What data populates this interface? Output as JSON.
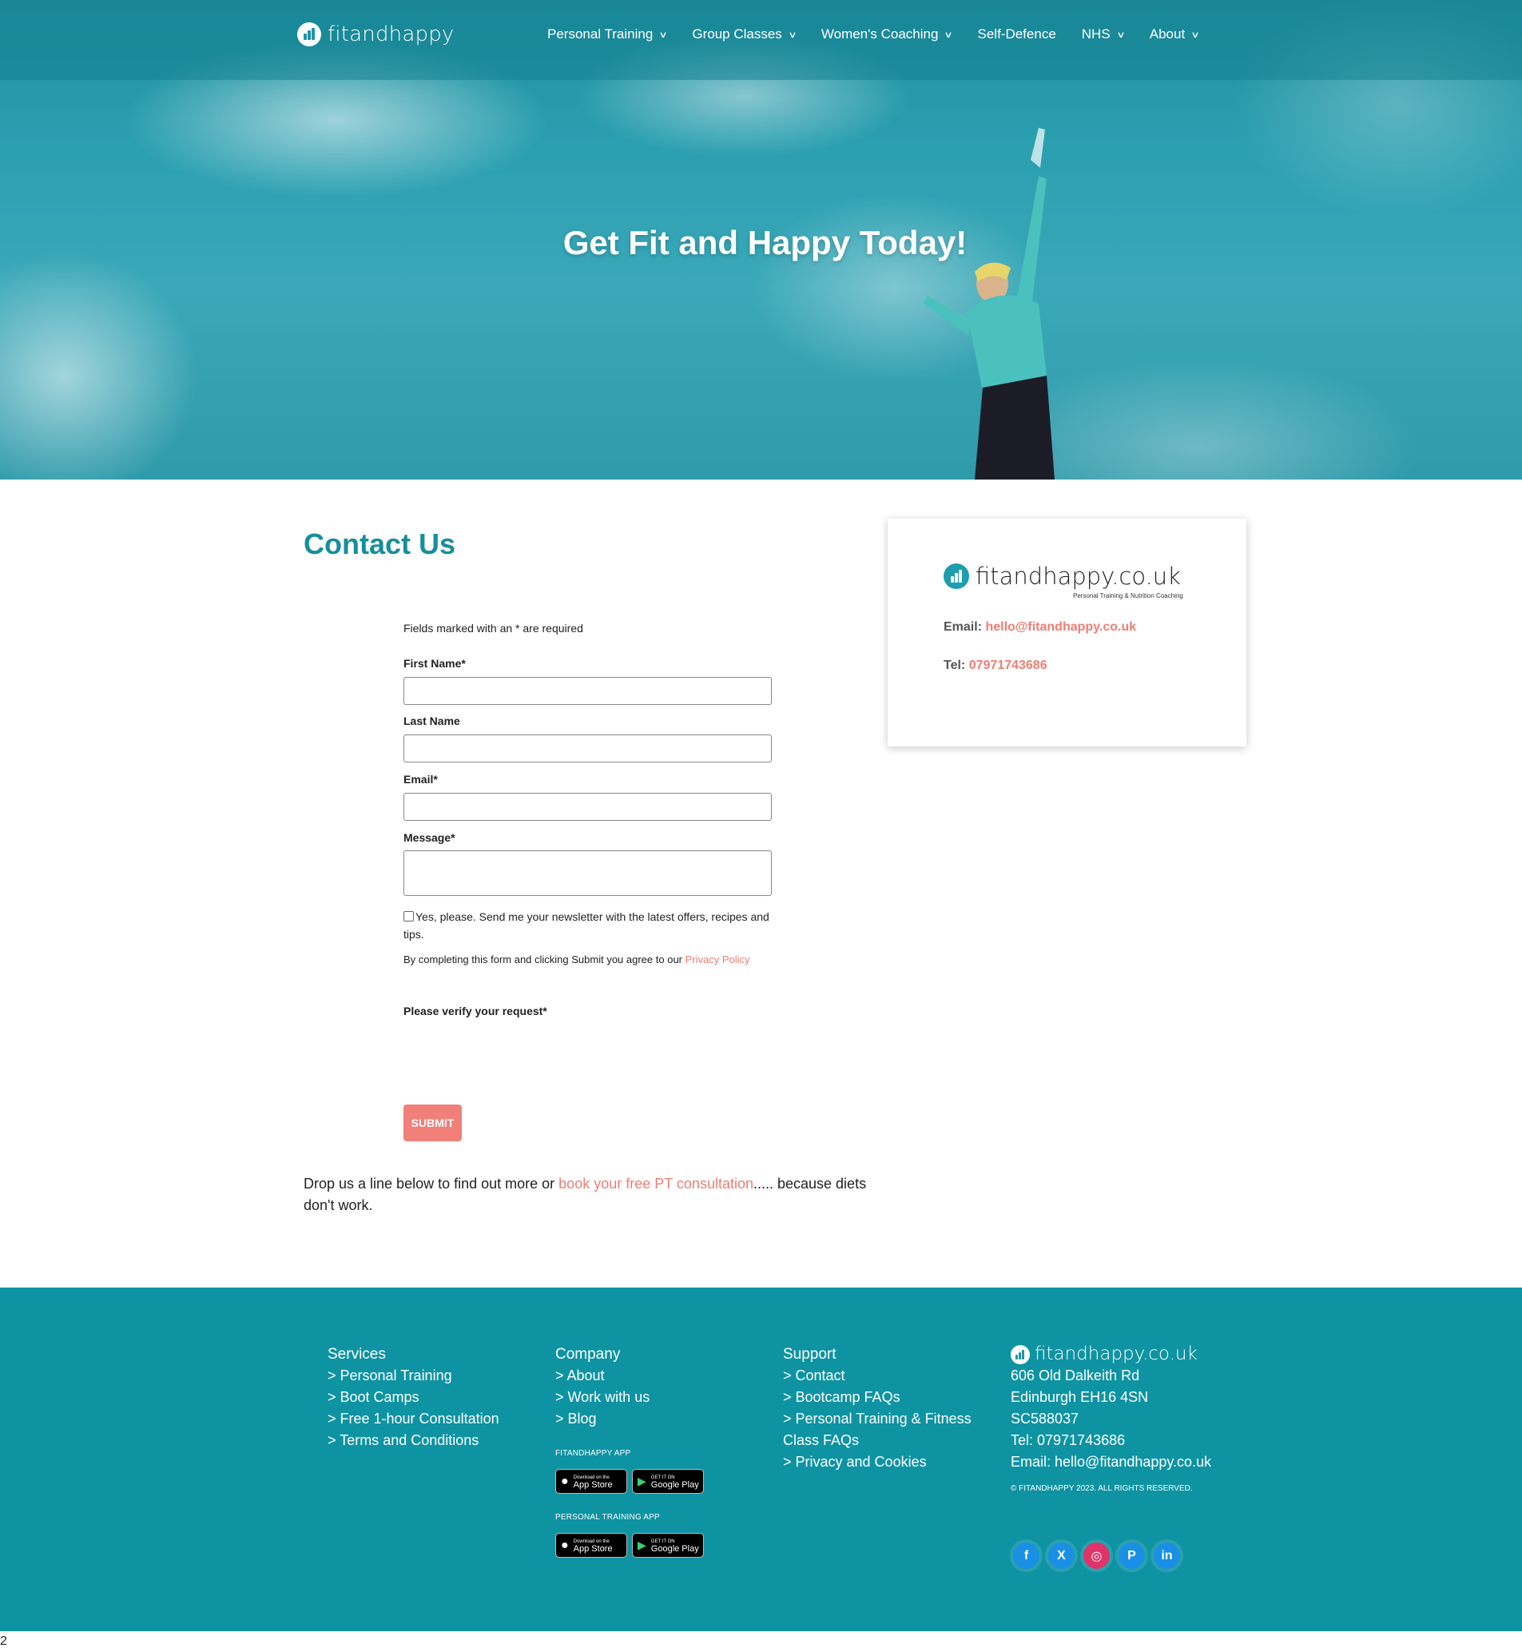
{
  "brand": {
    "name": "fitandhappy",
    "domain": "fitandhappy.co.uk",
    "tagline": "Personal Training & Nutrition Coaching",
    "accent": "#178e9b",
    "link_color": "#f07d74"
  },
  "nav": {
    "items": [
      {
        "label": "Personal Training",
        "has_dropdown": true
      },
      {
        "label": "Group Classes",
        "has_dropdown": true
      },
      {
        "label": "Women's Coaching",
        "has_dropdown": true
      },
      {
        "label": "Self-Defence",
        "has_dropdown": false
      },
      {
        "label": "NHS",
        "has_dropdown": true
      },
      {
        "label": "About",
        "has_dropdown": true
      }
    ]
  },
  "hero": {
    "title": "Get Fit and Happy Today!"
  },
  "contact": {
    "title": "Contact Us",
    "required_note": "Fields marked with an * are required",
    "fields": {
      "first_name": {
        "label": "First Name*",
        "value": ""
      },
      "last_name": {
        "label": "Last Name",
        "value": ""
      },
      "email": {
        "label": "Email*",
        "value": ""
      },
      "message": {
        "label": "Message*",
        "value": ""
      }
    },
    "newsletter_label": "Yes, please. Send me your newsletter with the latest offers, recipes and tips.",
    "newsletter_checked": false,
    "agree_text": "By completing this form and clicking Submit you agree to our ",
    "privacy_link": "Privacy Policy",
    "verify_label": "Please verify your request*",
    "submit_label": "SUBMIT",
    "drop_text_before": "Drop us a line below to find out more or ",
    "drop_link": "book your free PT consultation",
    "drop_text_after": "..... because diets don't work."
  },
  "card": {
    "email_label": "Email:",
    "email": "hello@fitandhappy.co.uk",
    "tel_label": "Tel:",
    "tel": "07971743686"
  },
  "footer": {
    "services": {
      "heading": "Services",
      "links": [
        "> Personal Training",
        "> Boot Camps",
        "> Free 1-hour Consultation",
        "> Terms and Conditions"
      ]
    },
    "company": {
      "heading": "Company",
      "links": [
        "> About",
        "> Work with us",
        "> Blog"
      ],
      "app1_label": "FITANDHAPPY APP",
      "app2_label": "PERSONAL TRAINING APP",
      "appstore_small": "Download on the",
      "appstore_big": "App Store",
      "gplay_small": "GET IT ON",
      "gplay_big": "Google Play"
    },
    "support": {
      "heading": "Support",
      "links": [
        "> Contact",
        "> Bootcamp FAQs",
        "> Personal Training & Fitness Class FAQs",
        "> Privacy and Cookies"
      ]
    },
    "address": {
      "logo": "fitandhappy.co.uk",
      "lines": [
        "606 Old Dalkeith Rd",
        "Edinburgh EH16 4SN",
        "SC588037",
        "Tel: 07971743686",
        "Email: hello@fitandhappy.co.uk"
      ],
      "copyright": "© FITANDHAPPY 2023. ALL RIGHTS RESERVED."
    },
    "socials": [
      {
        "icon": "facebook-icon",
        "glyph": "f"
      },
      {
        "icon": "x-icon",
        "glyph": "X"
      },
      {
        "icon": "instagram-icon",
        "glyph": "◎"
      },
      {
        "icon": "pinterest-icon",
        "glyph": "P"
      },
      {
        "icon": "linkedin-icon",
        "glyph": "in"
      }
    ]
  },
  "page_marker": "2"
}
